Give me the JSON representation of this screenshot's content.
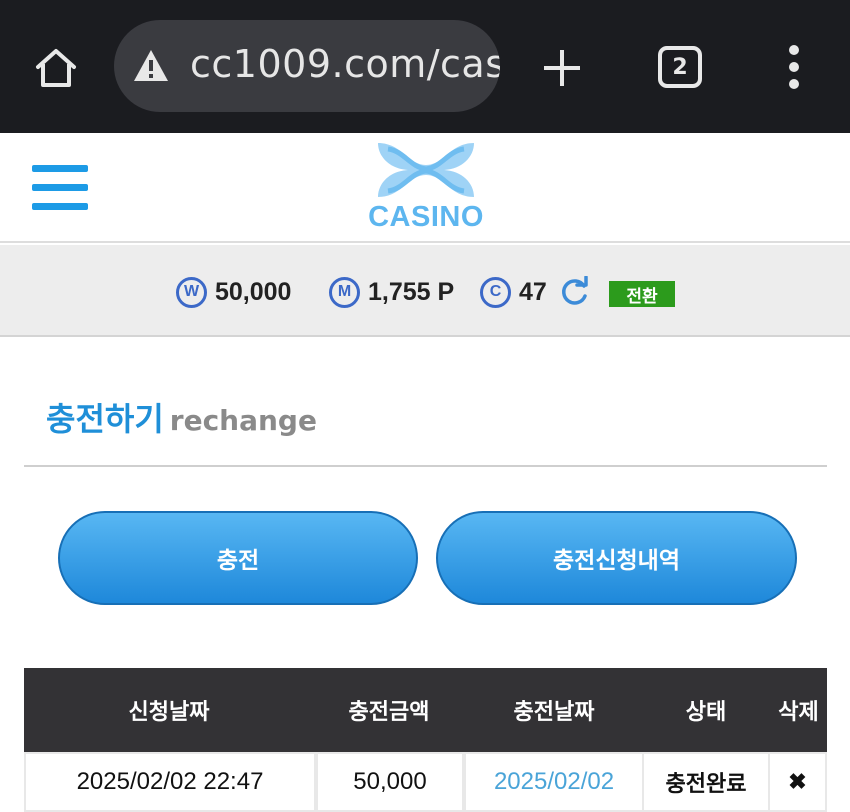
{
  "browser": {
    "url": "cc1009.com/cash",
    "tab_count": "2"
  },
  "header": {
    "logo_text": "CASINO"
  },
  "balance": {
    "won_symbol": "W",
    "won_value": "50,000",
    "point_symbol": "M",
    "point_value": "1,755 P",
    "comp_symbol": "C",
    "comp_value": "47",
    "switch_label": "전환"
  },
  "section": {
    "title_ko": "충전하기",
    "title_en": "rechange"
  },
  "buttons": {
    "recharge_label": "충전",
    "history_label": "충전신청내역"
  },
  "table": {
    "headers": [
      "신청날짜",
      "충전금액",
      "충전날짜",
      "상태",
      "삭제"
    ],
    "rows": [
      {
        "request_date": "2025/02/02 22:47",
        "amount": "50,000",
        "charge_date": "2025/02/02",
        "status": "충전완료",
        "delete": "✖"
      }
    ]
  },
  "colors": {
    "accent_blue": "#1f8fd8",
    "button_blue": "#2a95e0",
    "switch_green": "#2c9b1c",
    "table_header": "#333235",
    "coin_blue": "#3c69c8"
  },
  "icons": {
    "home": "home-icon",
    "warning": "warning-icon",
    "new_tab": "plus-icon",
    "more": "more-vert-icon",
    "menu": "hamburger-icon",
    "refresh": "refresh-icon"
  }
}
